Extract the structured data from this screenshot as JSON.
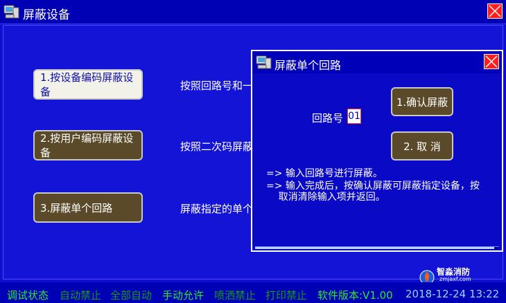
{
  "window": {
    "title": "屏蔽设备"
  },
  "menu": [
    {
      "label": "1.按设备编码屏蔽设备",
      "desc": "按照回路号和一"
    },
    {
      "label": "2.按用户编码屏蔽设备",
      "desc": "按照二次码屏蔽"
    },
    {
      "label": "3.屏蔽单个回路",
      "desc": "屏蔽指定的单个"
    }
  ],
  "dialog": {
    "title": "屏蔽单个回路",
    "loop_label": "回路号",
    "loop_value": "01",
    "confirm_label": "1.确认屏蔽",
    "cancel_label": "2. 取  消",
    "hints": [
      "=>  输入回路号进行屏蔽。",
      "=>  输入完成后，按确认屏蔽可屏蔽指定设备，按",
      "    取消清除输入项并返回。"
    ],
    "progress": 0.98
  },
  "status": {
    "items": [
      {
        "text": "调试状态",
        "state": "on"
      },
      {
        "text": "自动禁止",
        "state": "off"
      },
      {
        "text": "全部自动",
        "state": "off"
      },
      {
        "text": "手动允许",
        "state": "on"
      },
      {
        "text": "喷洒禁止",
        "state": "off"
      },
      {
        "text": "打印禁止",
        "state": "off"
      }
    ],
    "version": "软件版本:V1.00",
    "datetime": "2018-12-24 13:22"
  },
  "watermark": {
    "name": "智淼消防",
    "url": "zmjaxf.com"
  },
  "colors": {
    "background": "#0f0fcf",
    "close": "#ff1e1e",
    "status_on": "#2fe62f",
    "status_off": "#169a16"
  },
  "icons": {
    "app": "computer-icon",
    "close": "close-icon"
  }
}
